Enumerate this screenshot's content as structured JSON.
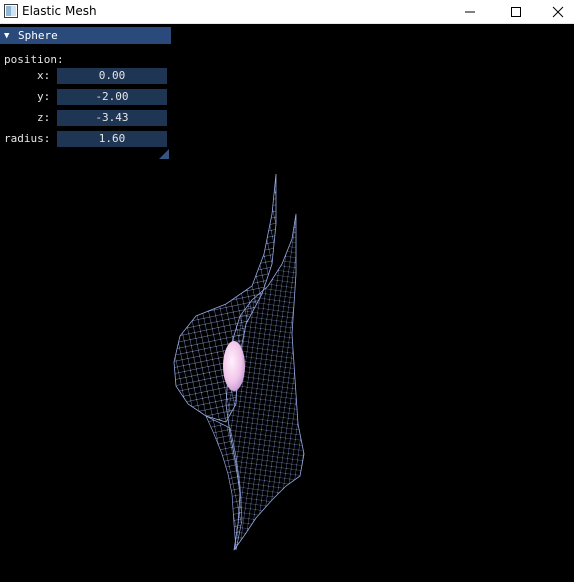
{
  "window": {
    "title": "Elastic Mesh",
    "controls": {
      "minimize": "minimize-icon",
      "maximize": "maximize-icon",
      "close": "close-icon"
    }
  },
  "panel": {
    "header": "Sphere",
    "collapse_icon": "triangle-down-icon",
    "position_label": "position:",
    "fields": {
      "x": {
        "label": "x:",
        "value": "0.00"
      },
      "y": {
        "label": "y:",
        "value": "-2.00"
      },
      "z": {
        "label": "z:",
        "value": "-3.43"
      },
      "radius": {
        "label": "radius:",
        "value": "1.60"
      }
    }
  },
  "colors": {
    "background": "#000000",
    "panel_header": "#294a7a",
    "field_bg": "#1e3554",
    "mesh": "#9fb4f0",
    "sphere": "#f2c6ea"
  }
}
